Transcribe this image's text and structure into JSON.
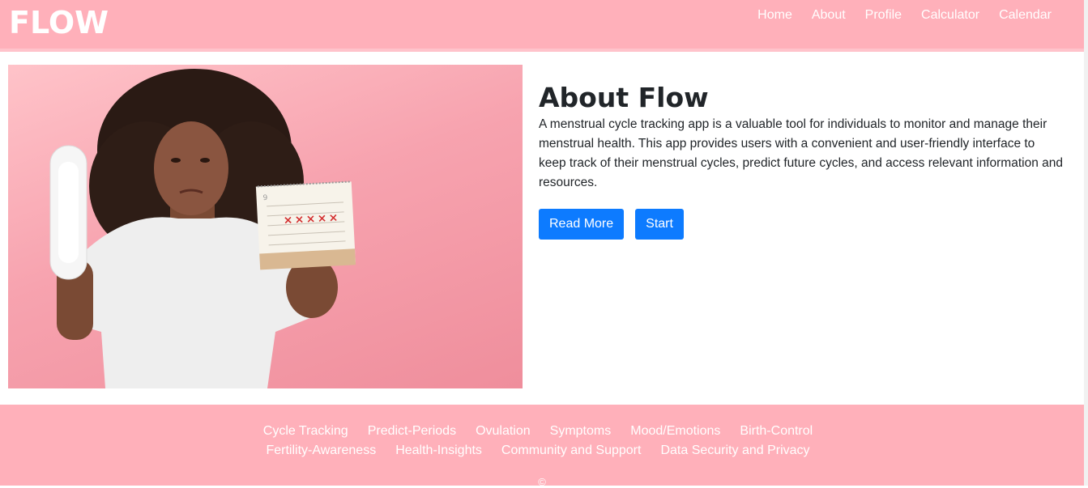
{
  "header": {
    "brand": "FLOW",
    "nav": [
      "Home",
      "About",
      "Profile",
      "Calculator",
      "Calendar"
    ]
  },
  "hero": {
    "image_alt": "woman holding pad and calendar"
  },
  "about": {
    "title": "About Flow",
    "description": "A menstrual cycle tracking app is a valuable tool for individuals to monitor and manage their menstrual health. This app provides users with a convenient and user-friendly interface to keep track of their menstrual cycles, predict future cycles, and access relevant information and resources.",
    "read_more_label": "Read More",
    "start_label": "Start"
  },
  "footer": {
    "row1": [
      "Cycle Tracking",
      "Predict-Periods",
      "Ovulation",
      "Symptoms",
      "Mood/Emotions",
      "Birth-Control"
    ],
    "row2": [
      "Fertility-Awareness",
      "Health-Insights",
      "Community and Support",
      "Data Security and Privacy"
    ],
    "copyright": "©"
  },
  "colors": {
    "header_bg": "#ffb0ba",
    "button_bg": "#0d7bff"
  }
}
